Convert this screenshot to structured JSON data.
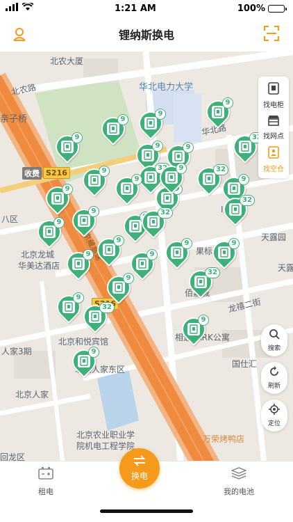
{
  "status_bar": {
    "time": "1:21 AM",
    "battery": "100%"
  },
  "header": {
    "title": "锂纳斯换电"
  },
  "map": {
    "labels": [
      {
        "text": "北农大厦",
        "color": "gray"
      },
      {
        "text": "北农路",
        "color": "gray"
      },
      {
        "text": "华北电力大学",
        "color": "blue"
      },
      {
        "text": "亲子桥",
        "color": "gray"
      },
      {
        "text": "华北路",
        "color": "gray"
      },
      {
        "text": "收费",
        "color": "badge"
      },
      {
        "text": "S216",
        "color": "badge"
      },
      {
        "text": "八区",
        "color": "gray"
      },
      {
        "text": "I厦",
        "color": "gray"
      },
      {
        "text": "天露园",
        "color": "gray"
      },
      {
        "text": "北京龙城",
        "color": "gray"
      },
      {
        "text": "华美达酒店",
        "color": "gray"
      },
      {
        "text": "果标",
        "color": "gray"
      },
      {
        "text": "天露",
        "color": "gray"
      },
      {
        "text": "佰嘉城",
        "color": "gray"
      },
      {
        "text": "龙禧二街",
        "color": "gray"
      },
      {
        "text": "S216",
        "color": "badge"
      },
      {
        "text": "京藏高速",
        "color": "gray"
      },
      {
        "text": "北京和悦宾馆",
        "color": "gray"
      },
      {
        "text": "相遇PARK公寓",
        "color": "gray"
      },
      {
        "text": "人家3期",
        "color": "gray"
      },
      {
        "text": "国仕汇",
        "color": "gray"
      },
      {
        "text": "北京人家东区",
        "color": "gray"
      },
      {
        "text": "北京人家",
        "color": "gray"
      },
      {
        "text": "北京农业职业学",
        "color": "gray"
      },
      {
        "text": "院机电工程学院",
        "color": "gray"
      },
      {
        "text": "万荣烤鸭店",
        "color": "orange"
      },
      {
        "text": "回龙区",
        "color": "gray"
      }
    ],
    "pins": [
      {
        "count": "9"
      },
      {
        "count": "9"
      },
      {
        "count": "9"
      },
      {
        "count": "9"
      },
      {
        "count": "9"
      },
      {
        "count": "9"
      },
      {
        "count": "32"
      },
      {
        "count": "9"
      },
      {
        "count": "32"
      },
      {
        "count": "32"
      },
      {
        "count": "9"
      },
      {
        "count": "9"
      },
      {
        "count": "9"
      },
      {
        "count": "9"
      },
      {
        "count": "32"
      },
      {
        "count": "9"
      },
      {
        "count": "9"
      },
      {
        "count": "32"
      },
      {
        "count": "9"
      },
      {
        "count": "9"
      },
      {
        "count": "9"
      },
      {
        "count": "9"
      },
      {
        "count": "9"
      },
      {
        "count": "9"
      },
      {
        "count": "9"
      },
      {
        "count": "9"
      },
      {
        "count": "32"
      },
      {
        "count": "9"
      },
      {
        "count": "32"
      },
      {
        "count": "9"
      },
      {
        "count": "9"
      }
    ]
  },
  "filters": [
    {
      "label": "找电柜",
      "icon": "cabinet-icon"
    },
    {
      "label": "找网点",
      "icon": "store-icon"
    },
    {
      "label": "找空仓",
      "icon": "empty-slot-icon",
      "active": true
    }
  ],
  "map_controls": {
    "search": "搜索",
    "refresh": "刷新",
    "locate": "定位"
  },
  "bottom_nav": {
    "rent": "租电",
    "swap": "换电",
    "my_battery": "我的电池"
  },
  "colors": {
    "accent": "#f59a1a",
    "pin": "#3fb07a"
  }
}
